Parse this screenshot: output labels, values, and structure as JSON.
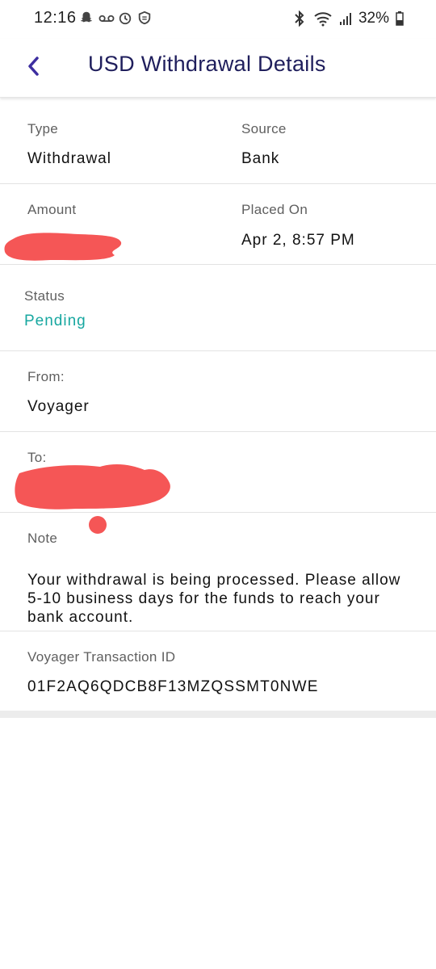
{
  "status_bar": {
    "time": "12:16",
    "battery": "32%",
    "left_icons": [
      "snapchat-icon",
      "voicemail-icon",
      "alarm-icon",
      "shield-icon"
    ],
    "right_icons": [
      "bluetooth-icon",
      "wifi-icon",
      "signal-icon",
      "battery-icon"
    ]
  },
  "header": {
    "title": "USD Withdrawal Details",
    "back_icon": "chevron-left-icon",
    "accent_color": "#3d2ea0"
  },
  "details": {
    "type_label": "Type",
    "type_value": "Withdrawal",
    "source_label": "Source",
    "source_value": "Bank",
    "amount_label": "Amount",
    "placed_on_label": "Placed On",
    "placed_on_value": "Apr 2, 8:57 PM",
    "status_label": "Status",
    "status_value": "Pending",
    "status_color": "#17a7a0",
    "from_label": "From:",
    "from_value": "Voyager",
    "to_label": "To:",
    "note_label": "Note",
    "note_value": "Your withdrawal is being processed. Please allow 5-10 business days for the funds to reach your bank account.",
    "transaction_id_label": "Voyager Transaction ID",
    "transaction_id_value": "01F2AQ6QDCB8F13MZQSSMT0NWE"
  },
  "redaction_color": "#f55656"
}
